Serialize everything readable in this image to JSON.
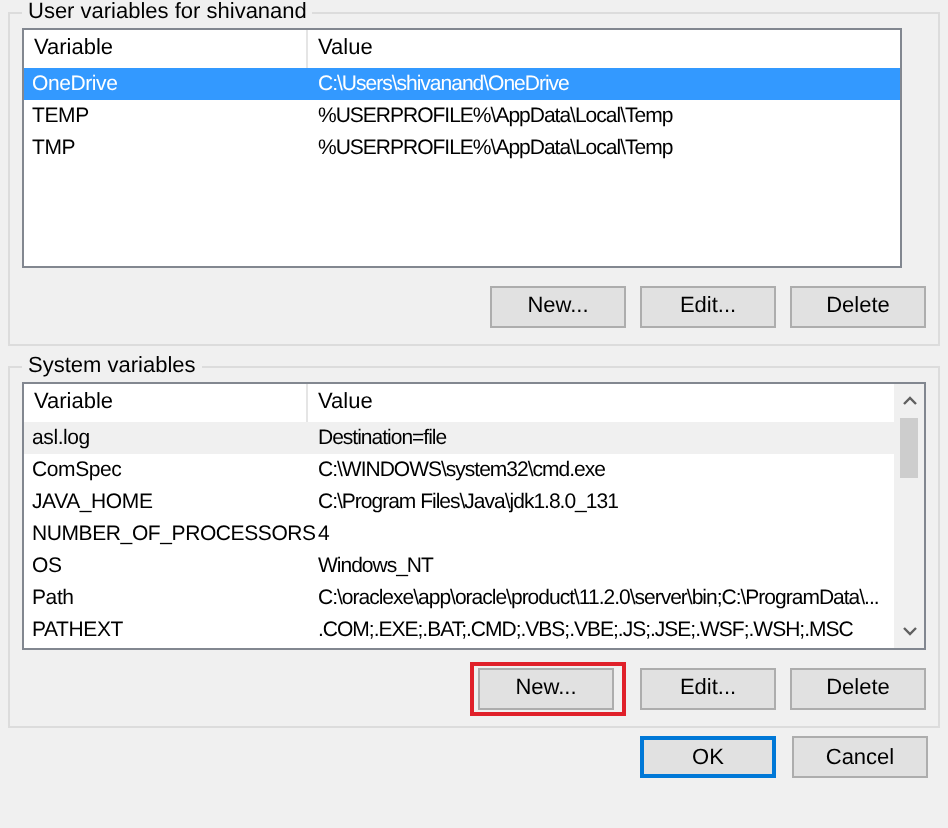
{
  "groups": [
    {
      "title": "User variables for shivanand",
      "focused": true,
      "columns": [
        "Variable",
        "Value"
      ],
      "rows": [
        {
          "variable": "OneDrive",
          "value": "C:\\Users\\shivanand\\OneDrive",
          "selected": true
        },
        {
          "variable": "TEMP",
          "value": "%USERPROFILE%\\AppData\\Local\\Temp",
          "selected": false
        },
        {
          "variable": "TMP",
          "value": "%USERPROFILE%\\AppData\\Local\\Temp",
          "selected": false
        }
      ],
      "scrollbar": false,
      "buttons": [
        {
          "label": "New...",
          "highlighted": false
        },
        {
          "label": "Edit...",
          "highlighted": false
        },
        {
          "label": "Delete",
          "highlighted": false
        }
      ]
    },
    {
      "title": "System variables",
      "focused": false,
      "columns": [
        "Variable",
        "Value"
      ],
      "rows": [
        {
          "variable": "asl.log",
          "value": "Destination=file",
          "selected": true
        },
        {
          "variable": "ComSpec",
          "value": "C:\\WINDOWS\\system32\\cmd.exe",
          "selected": false
        },
        {
          "variable": "JAVA_HOME",
          "value": "C:\\Program Files\\Java\\jdk1.8.0_131",
          "selected": false
        },
        {
          "variable": "NUMBER_OF_PROCESSORS",
          "value": "4",
          "selected": false
        },
        {
          "variable": "OS",
          "value": "Windows_NT",
          "selected": false
        },
        {
          "variable": "Path",
          "value": "C:\\oraclexe\\app\\oracle\\product\\11.2.0\\server\\bin;C:\\ProgramData\\...",
          "selected": false
        },
        {
          "variable": "PATHEXT",
          "value": ".COM;.EXE;.BAT;.CMD;.VBS;.VBE;.JS;.JSE;.WSF;.WSH;.MSC",
          "selected": false
        }
      ],
      "scrollbar": true,
      "buttons": [
        {
          "label": "New...",
          "highlighted": true
        },
        {
          "label": "Edit...",
          "highlighted": false
        },
        {
          "label": "Delete",
          "highlighted": false
        }
      ]
    }
  ],
  "dialog_buttons": [
    {
      "label": "OK",
      "default": true
    },
    {
      "label": "Cancel",
      "default": false
    }
  ]
}
